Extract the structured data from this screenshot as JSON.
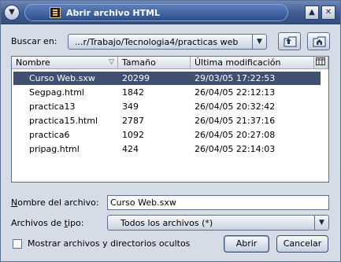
{
  "window": {
    "title": "Abrir archivo HTML"
  },
  "look_in": {
    "label": "Buscar en:",
    "path": "...r/Trabajo/Tecnologia4/practicas web"
  },
  "file_list": {
    "columns": [
      "Nombre",
      "Tamaño",
      "Última modificación"
    ],
    "rows": [
      {
        "name": "Curso Web.sxw",
        "size": "20299",
        "modified": "29/03/05 17:22:53",
        "selected": true
      },
      {
        "name": "Segpag.html",
        "size": "1842",
        "modified": "26/04/05 22:12:13",
        "selected": false
      },
      {
        "name": "practica13",
        "size": "349",
        "modified": "26/04/05 20:32:42",
        "selected": false
      },
      {
        "name": "practica15.html",
        "size": "2787",
        "modified": "26/04/05 21:37:16",
        "selected": false
      },
      {
        "name": "practica6",
        "size": "1092",
        "modified": "26/04/05 20:27:08",
        "selected": false
      },
      {
        "name": "pripag.html",
        "size": "424",
        "modified": "26/04/05 22:14:03",
        "selected": false
      }
    ]
  },
  "file_name": {
    "label": "Nombre del archivo:",
    "value": "Curso Web.sxw"
  },
  "file_type": {
    "label": "Archivos de tipo:",
    "value": "Todos los archivos (*)"
  },
  "show_hidden": {
    "label": "Mostrar archivos y directorios ocultos",
    "checked": false
  },
  "buttons": {
    "open": "Abrir",
    "cancel": "Cancelar"
  },
  "icons": {
    "window_menu": "chevron-down-icon",
    "app": "document-icon",
    "minimize": "triangle-up-icon",
    "close": "close-icon",
    "up_folder": "folder-up-icon",
    "home_folder": "folder-home-icon",
    "column_chooser": "column-settings-icon"
  },
  "colors": {
    "titlebar": "#3e5a8f",
    "selection": "#3f5073",
    "window_bg": "#d6dce6"
  }
}
